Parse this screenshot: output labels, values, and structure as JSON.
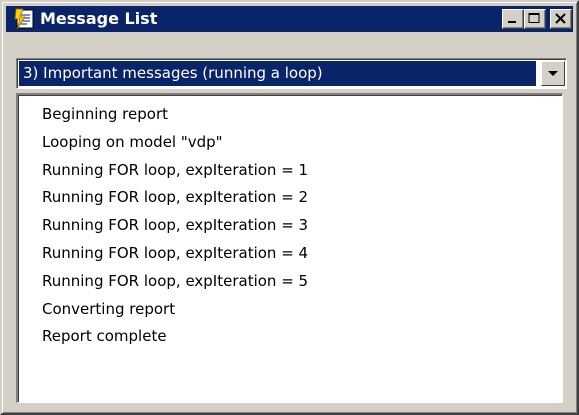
{
  "window": {
    "title": "Message List",
    "icon": "message-list-app-icon",
    "caption_buttons": [
      "minimize-icon",
      "maximize-icon",
      "close-icon"
    ]
  },
  "filter": {
    "selected": "3) Important messages (running a loop)",
    "dropdown_icon": "chevron-down-icon"
  },
  "messages": [
    "Beginning report",
    "Looping on model \"vdp\"",
    "Running FOR loop, expIteration = 1",
    "Running FOR loop, expIteration = 2",
    "Running FOR loop, expIteration = 3",
    "Running FOR loop, expIteration = 4",
    "Running FOR loop, expIteration = 5",
    "Converting report",
    "Report complete"
  ],
  "colors": {
    "titlebar": "#0a246a",
    "chrome": "#d4d0c8",
    "selection": "#0a246a",
    "list_background": "#ffffff"
  }
}
